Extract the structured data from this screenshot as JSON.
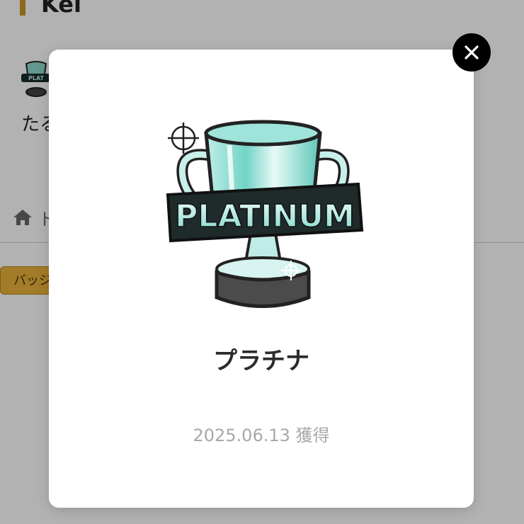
{
  "background_page": {
    "title": "Kei",
    "description": "たる",
    "home_label": "ト",
    "badge_tab_label": "バッジ"
  },
  "modal": {
    "badge_name": "プラチナ",
    "acquired_date": "2025.06.13 獲得",
    "trophy_text": "PLATINUM",
    "close_icon": "close-icon"
  },
  "colors": {
    "accent": "#c9972b",
    "badge_tab": "#e8b23a",
    "trophy_teal": "#6fd1c4",
    "overlay": "rgba(0,0,0,0.3)"
  }
}
